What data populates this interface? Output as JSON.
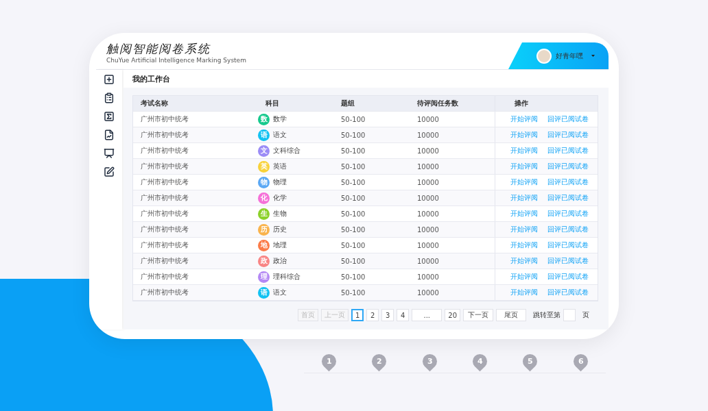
{
  "app": {
    "logo_title": "触阅智能阅卷系统",
    "logo_subtitle": "ChuYue Artificial Intelligence Marking System",
    "user_name": "好青年嘿"
  },
  "page_title": "我的工作台",
  "table": {
    "columns": [
      "考试名称",
      "科目",
      "题组",
      "待评阅任务数",
      "操作"
    ],
    "rows": [
      {
        "exam": "广州市初中统考",
        "badge": "数",
        "subject": "数学",
        "color": "#16c98d",
        "group": "50-100",
        "tasks": "10000",
        "actions": [
          "开始评阅",
          "回评已阅试卷"
        ]
      },
      {
        "exam": "广州市初中统考",
        "badge": "语",
        "subject": "语文",
        "color": "#12c2f2",
        "group": "50-100",
        "tasks": "10000",
        "actions": [
          "开始评阅",
          "回评已阅试卷"
        ]
      },
      {
        "exam": "广州市初中统考",
        "badge": "文",
        "subject": "文科综合",
        "color": "#9b8cf6",
        "group": "50-100",
        "tasks": "10000",
        "actions": [
          "开始评阅",
          "回评已阅试卷"
        ]
      },
      {
        "exam": "广州市初中统考",
        "badge": "英",
        "subject": "英语",
        "color": "#f8d23a",
        "group": "50-100",
        "tasks": "10000",
        "actions": [
          "开始评阅",
          "回评已阅试卷"
        ]
      },
      {
        "exam": "广州市初中统考",
        "badge": "物",
        "subject": "物理",
        "color": "#5ba8f4",
        "group": "50-100",
        "tasks": "10000",
        "actions": [
          "开始评阅",
          "回评已阅试卷"
        ]
      },
      {
        "exam": "广州市初中统考",
        "badge": "化",
        "subject": "化学",
        "color": "#f571d8",
        "group": "50-100",
        "tasks": "10000",
        "actions": [
          "开始评阅",
          "回评已阅试卷"
        ]
      },
      {
        "exam": "广州市初中统考",
        "badge": "生",
        "subject": "生物",
        "color": "#8cd12a",
        "group": "50-100",
        "tasks": "10000",
        "actions": [
          "开始评阅",
          "回评已阅试卷"
        ]
      },
      {
        "exam": "广州市初中统考",
        "badge": "历",
        "subject": "历史",
        "color": "#f9b34c",
        "group": "50-100",
        "tasks": "10000",
        "actions": [
          "开始评阅",
          "回评已阅试卷"
        ]
      },
      {
        "exam": "广州市初中统考",
        "badge": "地",
        "subject": "地理",
        "color": "#fb7b48",
        "group": "50-100",
        "tasks": "10000",
        "actions": [
          "开始评阅",
          "回评已阅试卷"
        ]
      },
      {
        "exam": "广州市初中统考",
        "badge": "政",
        "subject": "政治",
        "color": "#f88585",
        "group": "50-100",
        "tasks": "10000",
        "actions": [
          "开始评阅",
          "回评已阅试卷"
        ]
      },
      {
        "exam": "广州市初中统考",
        "badge": "理",
        "subject": "理科综合",
        "color": "#b488f4",
        "group": "50-100",
        "tasks": "10000",
        "actions": [
          "开始评阅",
          "回评已阅试卷"
        ]
      },
      {
        "exam": "广州市初中统考",
        "badge": "语",
        "subject": "语文",
        "color": "#12c2f2",
        "group": "50-100",
        "tasks": "10000",
        "actions": [
          "开始评阅",
          "回评已阅试卷"
        ]
      }
    ]
  },
  "pagination": {
    "items": [
      {
        "label": "首页",
        "selected": false,
        "disabled": true
      },
      {
        "label": "上一页",
        "selected": false,
        "disabled": true
      },
      {
        "label": "1",
        "selected": true,
        "disabled": false
      },
      {
        "label": "2",
        "selected": false,
        "disabled": false
      },
      {
        "label": "3",
        "selected": false,
        "disabled": false
      },
      {
        "label": "4",
        "selected": false,
        "disabled": false
      },
      {
        "label": "...",
        "selected": false,
        "disabled": false
      },
      {
        "label": "20",
        "selected": false,
        "disabled": false
      },
      {
        "label": "下一页",
        "selected": false,
        "disabled": false
      },
      {
        "label": "尾页",
        "selected": false,
        "disabled": false
      }
    ],
    "jump_label": "跳转至第",
    "jump_suffix": "页"
  },
  "steps": [
    "1",
    "2",
    "3",
    "4",
    "5",
    "6"
  ]
}
